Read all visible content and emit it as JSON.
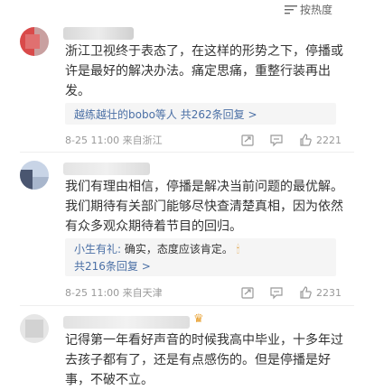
{
  "header": {
    "sort_label": "按热度"
  },
  "comments": [
    {
      "text": "浙江卫视终于表态了，在这样的形势之下，停播或许是最好的解决办法。痛定思痛，重整行装再出发。",
      "reply_preview": "",
      "reply_link": "越练越壮的bobo等人 共262条回复 >",
      "date": "8-25 11:00",
      "location": "来自浙江",
      "likes": "2221"
    },
    {
      "text": "我们有理由相信，停播是解决当前问题的最优解。我们期待有关部门能够尽快查清楚真相，因为依然有众多观众期待着节目的回归。",
      "reply_user": "小生有礼:",
      "reply_text": "确实，态度应该肯定。",
      "reply_link": "共216条回复 >",
      "date": "8-25 11:00",
      "location": "来自天津",
      "likes": "2231"
    },
    {
      "text": "记得第一年看好声音的时候我高中毕业，十多年过去孩子都有了，还是有点感伤的。但是停播是好事，不破不立。"
    }
  ],
  "colors": {
    "link": "#4a6fa5",
    "meta": "#999999",
    "reply_bg": "#f5f5f5"
  }
}
